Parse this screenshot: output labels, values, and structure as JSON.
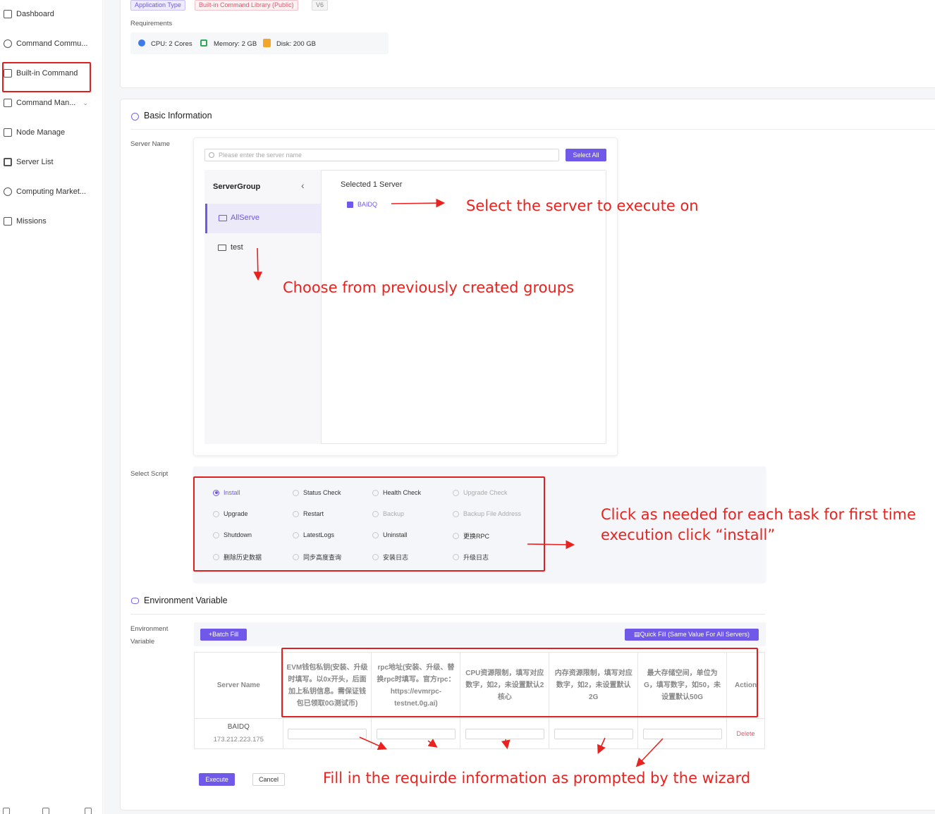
{
  "sidebar": {
    "items": [
      {
        "label": "Dashboard",
        "icon": "dashboard-icon"
      },
      {
        "label": "Command Commu...",
        "icon": "community-icon"
      },
      {
        "label": "Built-in Command",
        "icon": "built-in-command-icon"
      },
      {
        "label": "Command Man...",
        "icon": "command-manage-icon"
      },
      {
        "label": "Node Manage",
        "icon": "node-manage-icon"
      },
      {
        "label": "Server List",
        "icon": "server-list-icon"
      },
      {
        "label": "Computing Market...",
        "icon": "computing-market-icon"
      },
      {
        "label": "Missions",
        "icon": "missions-icon"
      }
    ]
  },
  "header_tags": {
    "app_type": "Application Type",
    "library": "Built-in Command Library (Public)",
    "version": "V6"
  },
  "requirements": {
    "label": "Requirements",
    "cpu": "CPU: 2 Cores",
    "memory": "Memory: 2 GB",
    "disk": "Disk: 200 GB"
  },
  "basic_info": {
    "title": "Basic Information",
    "server_name_label": "Server Name",
    "search_placeholder": "Please enter the server name",
    "select_all": "Select All",
    "server_group_title": "ServerGroup",
    "groups": [
      "AllServe",
      "test"
    ],
    "selected_count_text": "Selected 1 Server",
    "selected_server": "BAIDQ"
  },
  "select_script": {
    "label": "Select Script",
    "options": [
      {
        "label": "Install",
        "selected": true
      },
      {
        "label": "Status Check",
        "selected": false
      },
      {
        "label": "Health Check",
        "selected": false
      },
      {
        "label": "Upgrade Check",
        "selected": false
      },
      {
        "label": "Upgrade",
        "selected": false
      },
      {
        "label": "Restart",
        "selected": false
      },
      {
        "label": "Backup",
        "selected": false
      },
      {
        "label": "Backup File Address",
        "selected": false
      },
      {
        "label": "Shutdown",
        "selected": false
      },
      {
        "label": "LatestLogs",
        "selected": false
      },
      {
        "label": "Uninstall",
        "selected": false
      },
      {
        "label": "更换RPC",
        "selected": false
      },
      {
        "label": "删除历史数据",
        "selected": false
      },
      {
        "label": "同步高度查询",
        "selected": false
      },
      {
        "label": "安装日志",
        "selected": false
      },
      {
        "label": "升级日志",
        "selected": false
      }
    ]
  },
  "env": {
    "title": "Environment Variable",
    "label_line1": "Environment",
    "label_line2": "Variable",
    "batch_fill": "+Batch Fill",
    "quick_fill": "Quick Fill (Same Value For All Servers)",
    "columns": {
      "server_name": "Server Name",
      "c1": "EVM钱包私钥(安装、升级时填写。以0x开头，后面加上私钥信息。需保证钱包已领取0G测试币)",
      "c2": "rpc地址(安装、升级、替换rpc时填写。官方rpc：https://evmrpc-testnet.0g.ai)",
      "c3": "CPU资源限制，填写对应数字，如2，未设置默认2核心",
      "c4": "内存资源限制，填写对应数字，如2，未设置默认2G",
      "c5": "最大存储空间，单位为G，填写数字，如50，未设置默认50G",
      "action": "Action"
    },
    "row": {
      "server": "BAIDQ",
      "ip": "173.212.223.175",
      "delete": "Delete"
    }
  },
  "footer": {
    "execute": "Execute",
    "cancel": "Cancel"
  },
  "annotations": {
    "select_server": "Select the server to execute on",
    "choose_groups": "Choose from previously created groups",
    "click_line1": "Click as needed for each task for first time",
    "click_line2": "execution click “install”",
    "fill_info": "Fill in the requirde  information as prompted  by the wizard"
  },
  "colors": {
    "primary": "#7058e8",
    "annotation": "#e8231f"
  }
}
